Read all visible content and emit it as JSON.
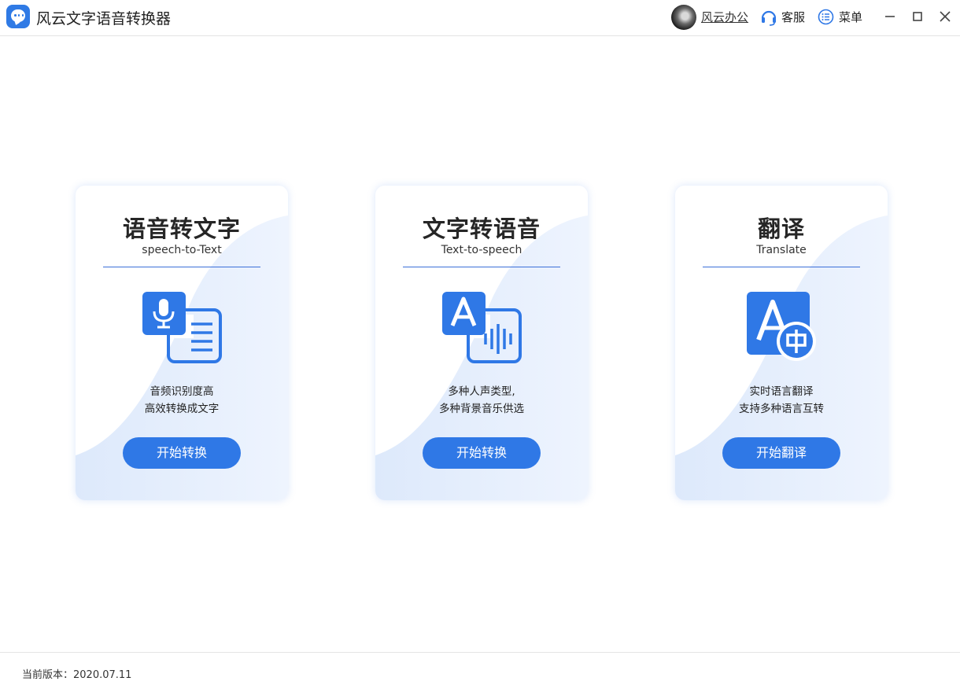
{
  "app": {
    "title": "风云文字语音转换器"
  },
  "header": {
    "user_name": "风云办公",
    "service_label": "客服",
    "menu_label": "菜单"
  },
  "cards": [
    {
      "title": "语音转文字",
      "subtitle": "speech-to-Text",
      "desc_line1": "音频识别度高",
      "desc_line2": "高效转换成文字",
      "button": "开始转换",
      "icon": "mic-to-document-icon"
    },
    {
      "title": "文字转语音",
      "subtitle": "Text-to-speech",
      "desc_line1": "多种人声类型,",
      "desc_line2": "多种背景音乐供选",
      "button": "开始转换",
      "icon": "text-to-audio-icon"
    },
    {
      "title": "翻译",
      "subtitle": "Translate",
      "desc_line1": "实时语言翻译",
      "desc_line2": "支持多种语言互转",
      "button": "开始翻译",
      "icon": "translate-icon"
    }
  ],
  "footer": {
    "version": "当前版本：2020.07.11"
  },
  "colors": {
    "accent": "#2f78e6",
    "card_wave": "#e8f1fd",
    "divider": "#3b6fd8"
  }
}
